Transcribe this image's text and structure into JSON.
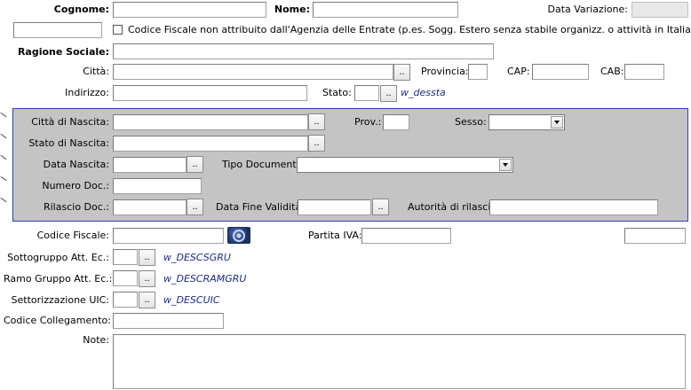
{
  "labels": {
    "cognome": "Cognome:",
    "nome": "Nome:",
    "data_variazione": "Data Variazione:",
    "codice_fiscale_note": "Codice Fiscale non attribuito dall'Agenzia delle Entrate (p.es. Sogg. Estero senza stabile organizz. o attività in Italia)",
    "ragione_sociale": "Ragione Sociale:",
    "citta": "Città:",
    "provincia": "Provincia:",
    "cap": "CAP:",
    "cab": "CAB:",
    "indirizzo": "Indirizzo:",
    "stato": "Stato:",
    "citta_nascita": "Città di Nascita:",
    "prov": "Prov.:",
    "sesso": "Sesso:",
    "stato_nascita": "Stato di Nascita:",
    "data_nascita": "Data Nascita:",
    "tipo_documento": "Tipo Documento:",
    "numero_doc": "Numero Doc.:",
    "rilascio_doc": "Rilascio Doc.:",
    "data_fine_validita": "Data Fine Validità:",
    "autorita_rilascio": "Autorità di rilascio:",
    "codice_fiscale": "Codice Fiscale:",
    "partita_iva": "Partita IVA:",
    "sottogruppo": "Sottogruppo Att. Ec.:",
    "ramo_gruppo": "Ramo Gruppo Att. Ec.:",
    "settorizzazione": "Settorizzazione UIC:",
    "codice_collegamento": "Codice Collegamento:",
    "note": "Note:"
  },
  "hints": {
    "stato": "w_dessta",
    "sottogruppo": "w_DESCSGRU",
    "ramo_gruppo": "w_DESCRAMGRU",
    "settorizzazione": "w_DESCUIC"
  },
  "buttons": {
    "zoom": ".."
  },
  "values": {
    "cognome": "",
    "nome": "",
    "data_variazione": "",
    "ragione_sociale": "",
    "citta": "",
    "provincia": "",
    "cap": "",
    "cab": "",
    "indirizzo": "",
    "stato": "",
    "citta_nascita": "",
    "prov": "",
    "sesso": "",
    "stato_nascita": "",
    "data_nascita": "",
    "tipo_documento": "",
    "numero_doc": "",
    "rilascio_doc": "",
    "data_fine_validita": "",
    "autorita_rilascio": "",
    "codice_fiscale": "",
    "partita_iva": "",
    "sottogruppo": "",
    "ramo_gruppo": "",
    "settorizzazione": "",
    "codice_collegamento": "",
    "note": ""
  },
  "colors": {
    "panel_bg": "#c4c4c4",
    "panel_border": "#2f3fb0",
    "hint_text": "#1d2a8e"
  },
  "icons": {
    "codice_fiscale_calc": "gear-icon"
  }
}
